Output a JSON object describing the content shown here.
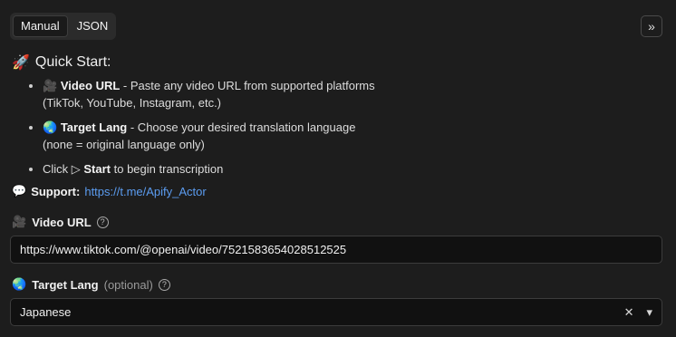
{
  "tabs": [
    {
      "label": "Manual"
    },
    {
      "label": "JSON"
    }
  ],
  "collapse_icon": "»",
  "quick_start": {
    "icon": "🚀",
    "title": "Quick Start:",
    "items": [
      {
        "icon": "🎥",
        "bold": "Video URL",
        "text": " - Paste any video URL from supported platforms",
        "line2": "(TikTok, YouTube, Instagram, etc.)"
      },
      {
        "icon": "🌏",
        "bold": "Target Lang",
        "text": " - Choose your desired translation language",
        "line2": "(none = original language only)"
      },
      {
        "prefix": "Click ▷ ",
        "bold": "Start",
        "text": " to begin transcription"
      }
    ]
  },
  "support": {
    "icon": "💬",
    "label": "Support:",
    "link": "https://t.me/Apify_Actor"
  },
  "video_url": {
    "icon": "🎥",
    "label": "Video URL",
    "help": "?",
    "value": "https://www.tiktok.com/@openai/video/7521583654028512525"
  },
  "target_lang": {
    "icon": "🌏",
    "label": "Target Lang",
    "optional": "(optional)",
    "help": "?",
    "value": "Japanese",
    "clear": "✕",
    "caret": "▾"
  }
}
